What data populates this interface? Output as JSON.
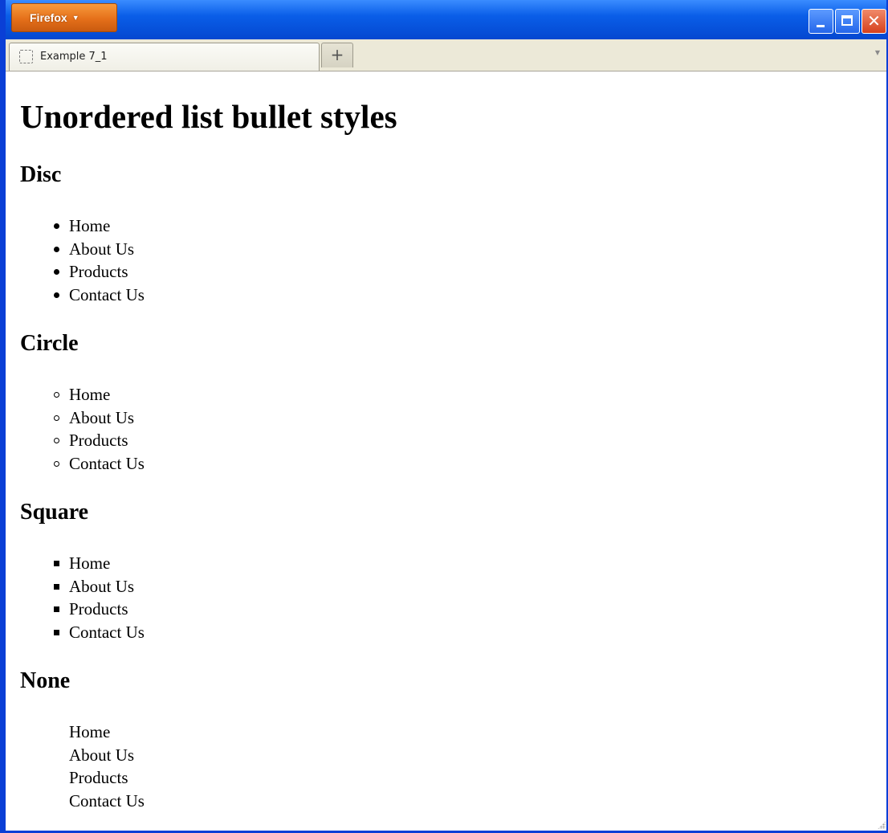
{
  "browser": {
    "menu_button_label": "Firefox",
    "menu_caret_icon": "triangle-down-icon",
    "window_controls": [
      "minimize-icon",
      "maximize-icon",
      "close-icon"
    ],
    "accent_color": "#0a3fd6",
    "menu_button_color": "#e5701a"
  },
  "tabs": [
    {
      "label": "Example 7_1",
      "icon": "blank-page-icon",
      "active": true
    }
  ],
  "tabstrip": {
    "new_tab_label": "+",
    "list_all_tabs_icon": "chevron-down-icon"
  },
  "page": {
    "title": "Unordered list bullet styles",
    "sections": [
      {
        "heading": "Disc",
        "bullet": "disc",
        "items": [
          "Home",
          "About Us",
          "Products",
          "Contact Us"
        ]
      },
      {
        "heading": "Circle",
        "bullet": "circle",
        "items": [
          "Home",
          "About Us",
          "Products",
          "Contact Us"
        ]
      },
      {
        "heading": "Square",
        "bullet": "square",
        "items": [
          "Home",
          "About Us",
          "Products",
          "Contact Us"
        ]
      },
      {
        "heading": "None",
        "bullet": "none",
        "items": [
          "Home",
          "About Us",
          "Products",
          "Contact Us"
        ]
      }
    ]
  }
}
